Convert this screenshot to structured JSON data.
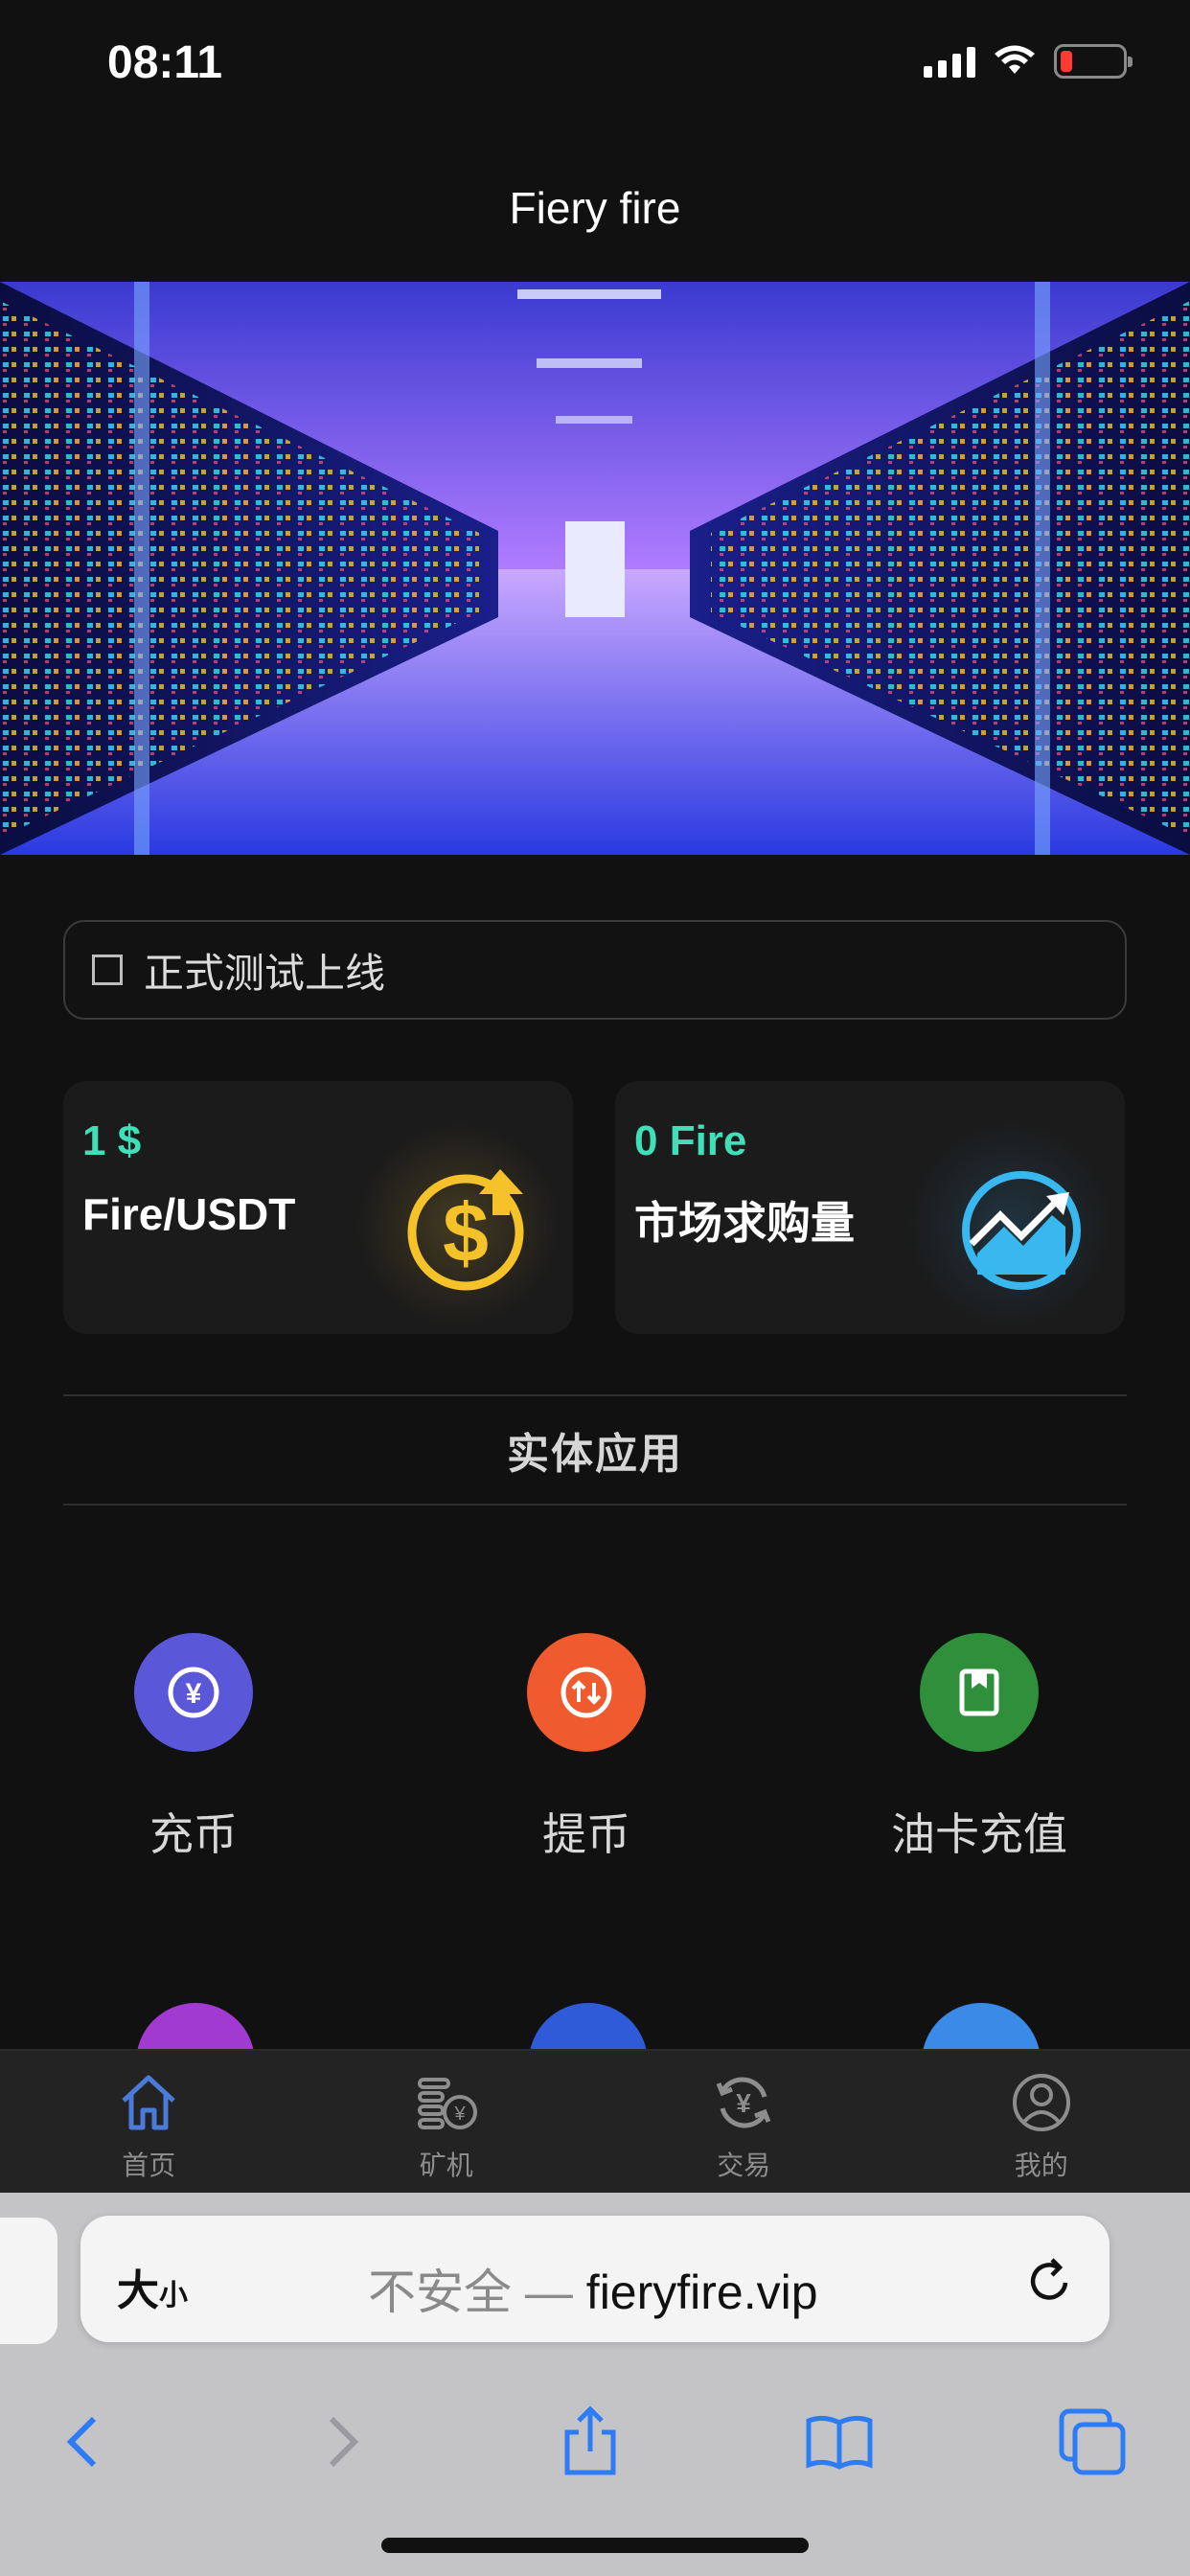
{
  "status_bar": {
    "time": "08:11",
    "battery_color": "#ff3b30"
  },
  "header": {
    "title": "Fiery fire"
  },
  "banner": {
    "alt": "server-room-image"
  },
  "notice": {
    "text": "正式测试上线"
  },
  "stats": [
    {
      "value": "1 $",
      "label": "Fire/USDT",
      "icon": "dollar-up-icon"
    },
    {
      "value": "0 Fire",
      "label": "市场求购量",
      "icon": "trend-chart-icon"
    }
  ],
  "section": {
    "title": "实体应用"
  },
  "apps": [
    {
      "label": "充币",
      "icon": "deposit-icon",
      "color": "#5a58d8"
    },
    {
      "label": "提币",
      "icon": "withdraw-icon",
      "color": "#ef5a2e"
    },
    {
      "label": "油卡充值",
      "icon": "oil-card-icon",
      "color": "#2f8f3a"
    }
  ],
  "tabs": [
    {
      "label": "首页",
      "icon": "home-icon",
      "active": true
    },
    {
      "label": "矿机",
      "icon": "miner-icon",
      "active": false
    },
    {
      "label": "交易",
      "icon": "trade-icon",
      "active": false
    },
    {
      "label": "我的",
      "icon": "profile-icon",
      "active": false
    }
  ],
  "browser": {
    "text_size_label": "大",
    "text_size_small": "小",
    "insecure_label": "不安全 — ",
    "domain": "fieryfire.vip"
  },
  "colors": {
    "accent": "#3fe0b8",
    "background": "#111111",
    "tab_active": "#4a7bd8"
  }
}
